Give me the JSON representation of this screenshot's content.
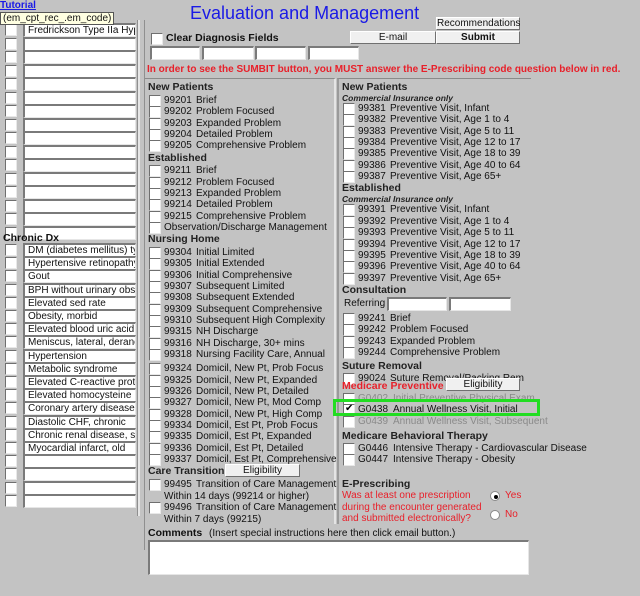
{
  "tutorial_link": "Tutorial",
  "tooltip": "(em_cpt_rec_.em_code)",
  "title": "Evaluation and Management",
  "buttons": {
    "recommendations": "Recommendations",
    "email": "E-mail",
    "submit": "Submit",
    "eligibility_care": "Eligibility",
    "eligibility_medicare": "Eligibility"
  },
  "clear_dx": {
    "label": "Clear Diagnosis Fields",
    "checked": false
  },
  "warning": "In order to see the SUMBIT button, you MUST answer the E-Prescribing code question below in red.",
  "left_list": {
    "top_items": [
      "Fredrickson Type IIa Hyp",
      "",
      "",
      "",
      "",
      "",
      "",
      "",
      "",
      "",
      "",
      "",
      "",
      "",
      "",
      ""
    ],
    "chronic_header": "Chronic Dx",
    "chronic_items": [
      "DM (diabetes mellitus) typ",
      "Hypertensive retinopathy",
      "Gout",
      "BPH without urinary obst",
      "Elevated sed rate",
      "Obesity, morbid",
      "Elevated blood uric acid l",
      "Meniscus, lateral, deranc",
      "Hypertension",
      "Metabolic syndrome",
      "Elevated C-reactive prote",
      "Elevated homocysteine",
      "Coronary artery disease",
      "Diastolic CHF, chronic",
      "Chronic renal disease, st",
      "Myocardial infarct, old",
      "",
      "",
      "",
      ""
    ]
  },
  "col1": {
    "new_patients": {
      "header": "New Patients",
      "items": [
        {
          "code": "99201",
          "label": "Brief"
        },
        {
          "code": "99202",
          "label": "Problem Focused"
        },
        {
          "code": "99203",
          "label": "Expanded Problem"
        },
        {
          "code": "99204",
          "label": "Detailed Problem"
        },
        {
          "code": "99205",
          "label": "Comprehensive Problem"
        }
      ]
    },
    "established": {
      "header": "Established",
      "items": [
        {
          "code": "99211",
          "label": "Brief"
        },
        {
          "code": "99212",
          "label": "Problem Focused"
        },
        {
          "code": "99213",
          "label": "Expanded Problem"
        },
        {
          "code": "99214",
          "label": "Detailed Problem"
        },
        {
          "code": "99215",
          "label": "Comprehensive Problem"
        },
        {
          "code": "",
          "label": "Observation/Discharge Management"
        }
      ]
    },
    "nursing_home": {
      "header": "Nursing Home",
      "items": [
        {
          "code": "99304",
          "label": "Initial Limited"
        },
        {
          "code": "99305",
          "label": "Initial Extended"
        },
        {
          "code": "99306",
          "label": "Initial Comprehensive"
        },
        {
          "code": "99307",
          "label": "Subsequent Limited"
        },
        {
          "code": "99308",
          "label": "Subsequent Extended"
        },
        {
          "code": "99309",
          "label": "Subsequent Comprehensive"
        },
        {
          "code": "99310",
          "label": "Subsequent High Complexity"
        },
        {
          "code": "99315",
          "label": "NH Discharge"
        },
        {
          "code": "99316",
          "label": "NH Discharge, 30+ mins"
        },
        {
          "code": "99318",
          "label": "Nursing Facility Care, Annual"
        }
      ]
    },
    "domicil": {
      "items": [
        {
          "code": "99324",
          "label": "Domicil, New Pt, Prob Focus"
        },
        {
          "code": "99325",
          "label": "Domicil, New Pt, Expanded"
        },
        {
          "code": "99326",
          "label": "Domicil, New Pt, Detailed"
        },
        {
          "code": "99327",
          "label": "Domicil, New Pt, Mod Comp"
        },
        {
          "code": "99328",
          "label": "Domicil, New Pt, High Comp"
        },
        {
          "code": "99334",
          "label": "Domicil, Est Pt, Prob Focus"
        },
        {
          "code": "99335",
          "label": "Domicil, Est Pt, Expanded"
        },
        {
          "code": "99336",
          "label": "Domicil, Est Pt, Detailed"
        },
        {
          "code": "99337",
          "label": "Domicil, Est Pt, Comprehensive"
        }
      ]
    },
    "care_transition": {
      "header": "Care Transition",
      "items": [
        {
          "code": "99495",
          "label": "Transition of Care Management",
          "line2": "Within 14 days (99214 or higher)"
        },
        {
          "code": "99496",
          "label": "Transition of Care Management",
          "line2": "Within 7 days (99215)"
        }
      ]
    }
  },
  "col2": {
    "new_patients": {
      "header": "New Patients",
      "subheader": "Commercial Insurance only",
      "items": [
        {
          "code": "99381",
          "label": "Preventive Visit, Infant"
        },
        {
          "code": "99382",
          "label": "Preventive Visit, Age 1 to 4"
        },
        {
          "code": "99383",
          "label": "Preventive Visit, Age 5 to 11"
        },
        {
          "code": "99384",
          "label": "Preventive Visit, Age 12 to 17"
        },
        {
          "code": "99385",
          "label": "Preventive Visit, Age 18 to 39"
        },
        {
          "code": "99386",
          "label": "Preventive Visit, Age 40 to 64"
        },
        {
          "code": "99387",
          "label": "Preventive Visit, Age 65+"
        }
      ]
    },
    "established": {
      "header": "Established",
      "subheader": "Commercial Insurance only",
      "items": [
        {
          "code": "99391",
          "label": "Preventive Visit, Infant"
        },
        {
          "code": "99392",
          "label": "Preventive Visit, Age 1 to 4"
        },
        {
          "code": "99393",
          "label": "Preventive Visit, Age 5 to 11"
        },
        {
          "code": "99394",
          "label": "Preventive Visit, Age 12 to 17"
        },
        {
          "code": "99395",
          "label": "Preventive Visit, Age 18 to 39"
        },
        {
          "code": "99396",
          "label": "Preventive Visit, Age 40 to 64"
        },
        {
          "code": "99397",
          "label": "Preventive Visit, Age 65+"
        }
      ]
    },
    "consultation": {
      "header": "Consultation",
      "referring_label": "Referring",
      "items": [
        {
          "code": "99241",
          "label": "Brief"
        },
        {
          "code": "99242",
          "label": "Problem Focused"
        },
        {
          "code": "99243",
          "label": "Expanded Problem"
        },
        {
          "code": "99244",
          "label": "Comprehensive Problem"
        }
      ]
    },
    "suture": {
      "header": "Suture Removal",
      "items": [
        {
          "code": "99024",
          "label": "Suture Removal/Packing Rem"
        }
      ]
    },
    "medicare_preventive": {
      "header": "Medicare Preventive",
      "items": [
        {
          "code": "G0402",
          "label": "Initial Preventive Physical Exam",
          "checked": false
        },
        {
          "code": "G0438",
          "label": "Annual Wellness Visit, Initial",
          "checked": true
        },
        {
          "code": "G0439",
          "label": "Annual Wellness Visit, Subsequent",
          "checked": false
        }
      ]
    },
    "behavioral": {
      "header": "Medicare Behavioral Therapy",
      "items": [
        {
          "code": "G0446",
          "label": "Intensive Therapy - Cardiovascular Disease"
        },
        {
          "code": "G0447",
          "label": "Intensive Therapy - Obesity"
        }
      ]
    },
    "eprescribing": {
      "header": "E-Prescribing",
      "question_lines": [
        "Was at least one prescription",
        "during the encounter generated",
        "and submitted electronically?"
      ],
      "options": [
        {
          "label": "Yes",
          "selected": true
        },
        {
          "label": "No",
          "selected": false
        }
      ]
    }
  },
  "comments": {
    "label": "Comments",
    "hint": "(Insert special instructions here then click email button.)",
    "value": ""
  },
  "highlight_color": "#22dd22",
  "title_color": "#1a1ae6",
  "warning_color": "#e8202a"
}
